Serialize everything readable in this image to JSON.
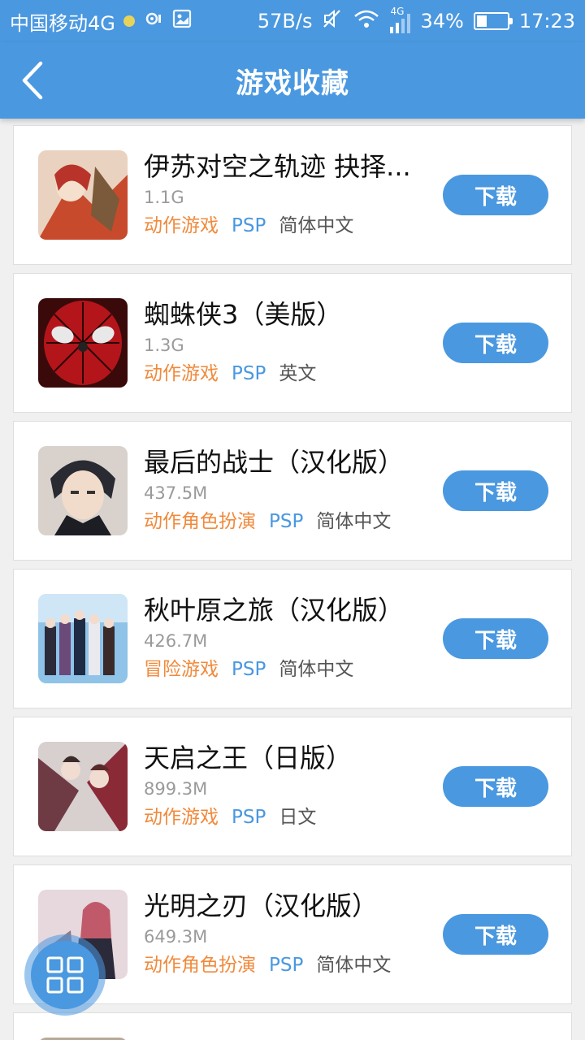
{
  "status_bar": {
    "carrier": "中国移动4G",
    "speed": "57B/s",
    "network": "4G",
    "battery": "34%",
    "battery_level": 0.34,
    "time": "17:23"
  },
  "header": {
    "title": "游戏收藏",
    "back_icon": "chevron-left-icon"
  },
  "games": [
    {
      "name": "伊苏对空之轨迹 抉择...",
      "size": "1.1G",
      "genre": "动作游戏",
      "platform": "PSP",
      "language": "简体中文",
      "download_label": "下载"
    },
    {
      "name": "蜘蛛侠3（美版）",
      "size": "1.3G",
      "genre": "动作游戏",
      "platform": "PSP",
      "language": "英文",
      "download_label": "下载"
    },
    {
      "name": "最后的战士（汉化版）",
      "size": "437.5M",
      "genre": "动作角色扮演",
      "platform": "PSP",
      "language": "简体中文",
      "download_label": "下载"
    },
    {
      "name": "秋叶原之旅（汉化版）",
      "size": "426.7M",
      "genre": "冒险游戏",
      "platform": "PSP",
      "language": "简体中文",
      "download_label": "下载"
    },
    {
      "name": "天启之王（日版）",
      "size": "899.3M",
      "genre": "动作游戏",
      "platform": "PSP",
      "language": "日文",
      "download_label": "下载"
    },
    {
      "name": "光明之刃（汉化版）",
      "size": "649.3M",
      "genre": "动作角色扮演",
      "platform": "PSP",
      "language": "简体中文",
      "download_label": "下载"
    }
  ],
  "fab": {
    "icon": "grid-icon"
  },
  "colors": {
    "primary": "#4a98e0",
    "genre": "#f08a3c",
    "platform": "#4a98e0"
  }
}
